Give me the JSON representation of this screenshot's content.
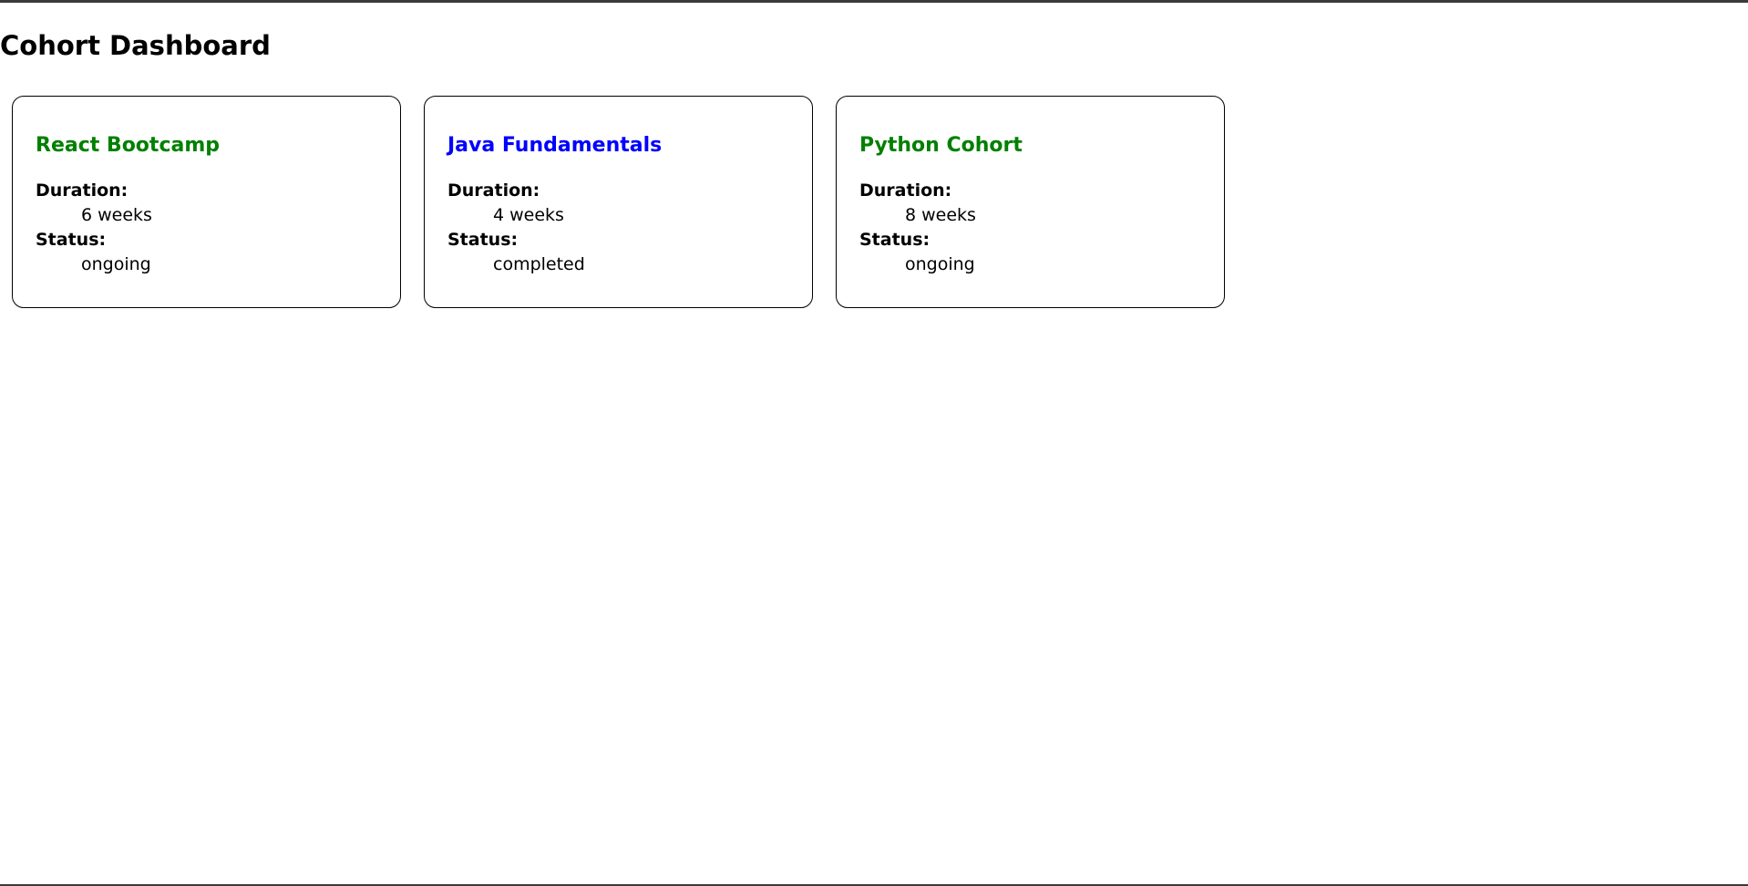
{
  "page": {
    "title": "Cohort Dashboard"
  },
  "labels": {
    "duration": "Duration:",
    "status": "Status:"
  },
  "cohorts": [
    {
      "name": "React Bootcamp",
      "duration": "6 weeks",
      "status": "ongoing",
      "title_color": "#008000"
    },
    {
      "name": "Java Fundamentals",
      "duration": "4 weeks",
      "status": "completed",
      "title_color": "#0000ff"
    },
    {
      "name": "Python Cohort",
      "duration": "8 weeks",
      "status": "ongoing",
      "title_color": "#008000"
    }
  ]
}
